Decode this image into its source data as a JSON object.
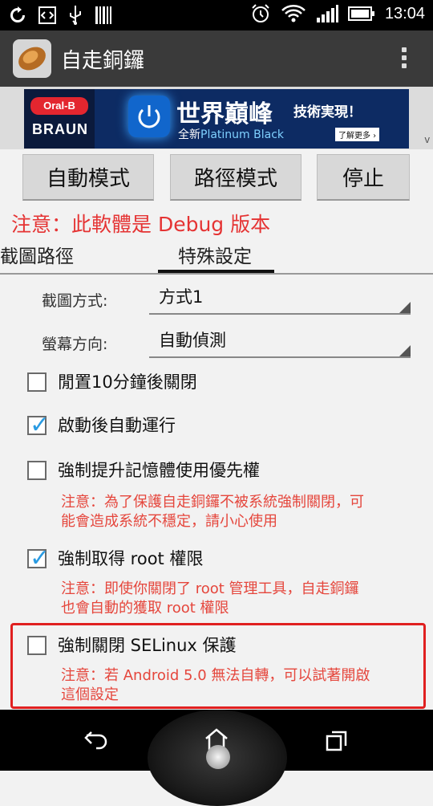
{
  "status_bar": {
    "time": "13:04"
  },
  "app": {
    "title": "自走銅鑼"
  },
  "ad": {
    "brand_top": "Oral-B",
    "brand_bottom": "BRAUN",
    "headline": "世界巔峰",
    "tagline": "技術実現！",
    "sub_prefix": "全新",
    "sub_highlight": "Platinum Black",
    "more_label": "了解更多 ›",
    "close_label": "v"
  },
  "buttons": {
    "auto_mode": "自動模式",
    "path_mode": "路徑模式",
    "stop": "停止"
  },
  "warning": "注意：此軟體是 Debug 版本",
  "tabs": {
    "screenshot_path": "截圖路徑",
    "special_settings": "特殊設定"
  },
  "settings": {
    "capture_method_label": "截圖方式:",
    "capture_method_value": "方式1",
    "screen_orientation_label": "螢幕方向:",
    "screen_orientation_value": "自動偵測",
    "opt_idle_close": "閒置10分鐘後關閉",
    "opt_auto_run": "啟動後自動運行",
    "opt_memory_priority": "強制提升記憶體使用優先權",
    "note_memory_priority_1": "注意：為了保護自走銅鑼不被系統強制關閉，可",
    "note_memory_priority_2": "能會造成系統不穩定，請小心使用",
    "opt_root": "強制取得 root 權限",
    "note_root_1": "注意：即使你關閉了 root 管理工具，自走銅鑼",
    "note_root_2": "也會自動的獲取 root 權限",
    "opt_selinux": "強制關閉 SELinux 保護",
    "note_selinux_1": "注意：若 Android 5.0 無法自轉，可以試著開啟",
    "note_selinux_2": "這個設定"
  },
  "checkbox_states": {
    "idle_close": false,
    "auto_run": true,
    "memory_priority": false,
    "root": true,
    "selinux": false
  },
  "colors": {
    "warning_red": "#e53333",
    "check_blue": "#2a9be2",
    "highlight_red": "#e02020"
  }
}
